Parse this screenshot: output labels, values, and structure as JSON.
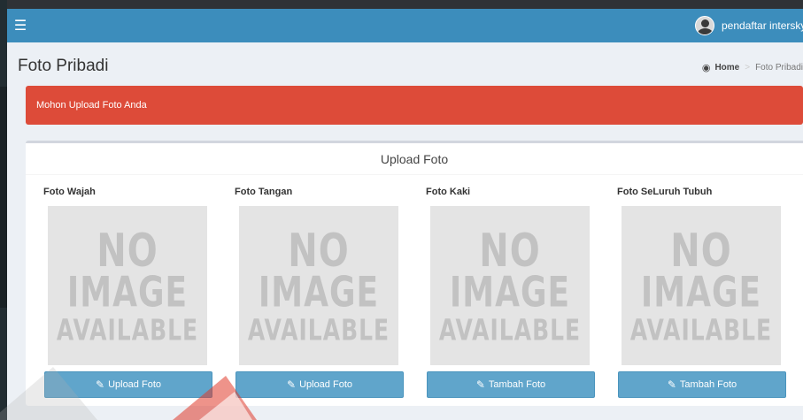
{
  "topbar": {
    "menu_icon": "hamburger-icon",
    "user_name": "pendaftar intersky"
  },
  "header": {
    "title": "Foto Pribadi",
    "breadcrumb": {
      "home_icon": "dashboard-icon",
      "home": "Home",
      "separator": ">",
      "current": "Foto Pribadi"
    }
  },
  "alert": {
    "message": "Mohon Upload Foto Anda",
    "color": "#dd4b39"
  },
  "box": {
    "title": "Upload Foto",
    "photos": [
      {
        "label": "Foto Wajah",
        "button": "Upload Foto"
      },
      {
        "label": "Foto Tangan",
        "button": "Upload Foto"
      },
      {
        "label": "Foto Kaki",
        "button": "Tambah Foto"
      },
      {
        "label": "Foto SeLuruh Tubuh",
        "button": "Tambah Foto"
      }
    ],
    "placeholder": {
      "line1": "NO",
      "line2": "IMAGE",
      "line3": "AVAILABLE"
    }
  },
  "colors": {
    "topbar": "#3c8dbc",
    "button": "#60a5cb",
    "background": "#ecf0f5"
  }
}
